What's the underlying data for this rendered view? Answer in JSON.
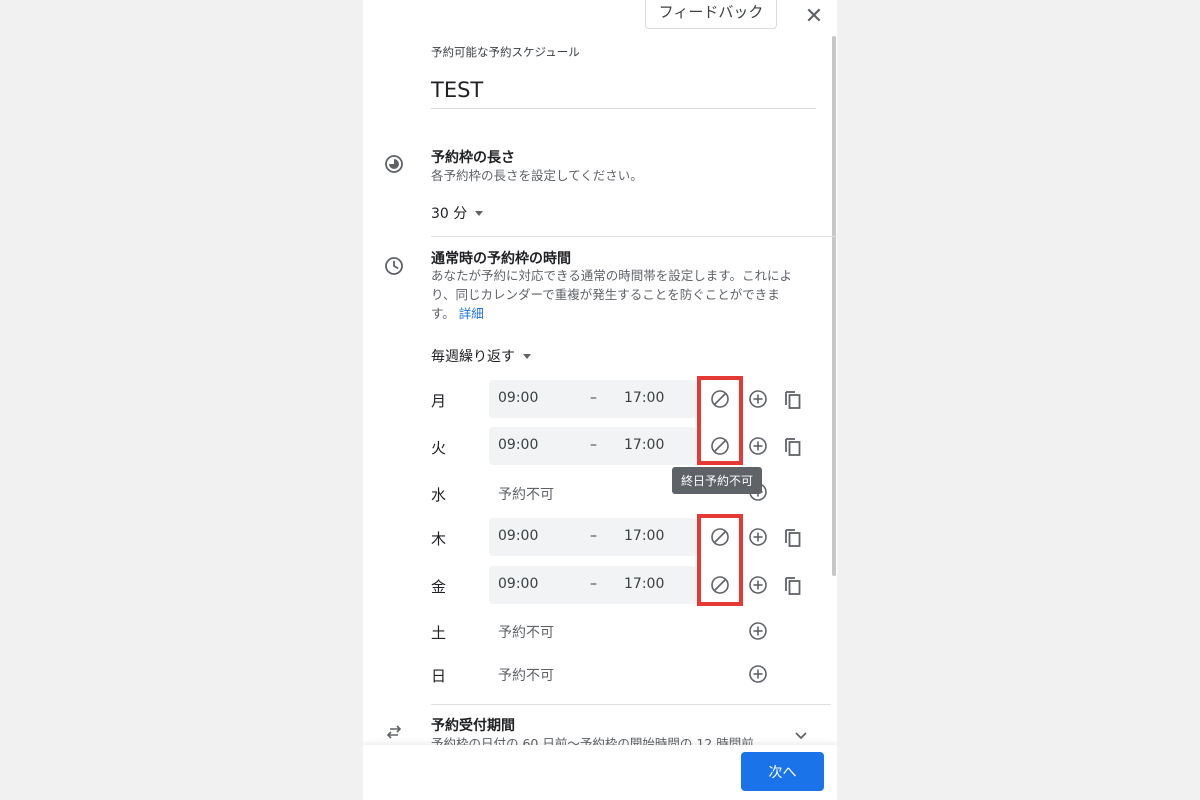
{
  "header": {
    "feedback_label": "フィードバック",
    "close_icon": "close-icon"
  },
  "schedule": {
    "title_label": "予約可能な予約スケジュール",
    "title_value": "TEST"
  },
  "slot_length": {
    "title": "予約枠の長さ",
    "description": "各予約枠の長さを設定してください。",
    "value": "30 分"
  },
  "general_availability": {
    "title": "通常時の予約枠の時間",
    "description_line1": "あなたが予約に対応できる通常の時間帯を設定します。これによ",
    "description_line2": "り、同じカレンダーで重複が発生することを防ぐことができま",
    "description_line3": "す。",
    "details_link": "詳細",
    "repeat_value": "毎週繰り返す",
    "days": [
      {
        "day": "月",
        "available": true,
        "start": "09:00",
        "dash": "–",
        "end": "17:00"
      },
      {
        "day": "火",
        "available": true,
        "start": "09:00",
        "dash": "–",
        "end": "17:00"
      },
      {
        "day": "水",
        "available": false,
        "text": "予約不可"
      },
      {
        "day": "木",
        "available": true,
        "start": "09:00",
        "dash": "–",
        "end": "17:00"
      },
      {
        "day": "金",
        "available": true,
        "start": "09:00",
        "dash": "–",
        "end": "17:00"
      },
      {
        "day": "土",
        "available": false,
        "text": "予約不可"
      },
      {
        "day": "日",
        "available": false,
        "text": "予約不可"
      }
    ],
    "tooltip": "終日予約不可"
  },
  "booking_window": {
    "title": "予約受付期間",
    "description": "予約枠の日付の 60 日前〜予約枠の開始時間の 12 時間前"
  },
  "footer": {
    "next_label": "次へ"
  },
  "colors": {
    "accent": "#1a73e8",
    "highlight": "#e53935"
  }
}
